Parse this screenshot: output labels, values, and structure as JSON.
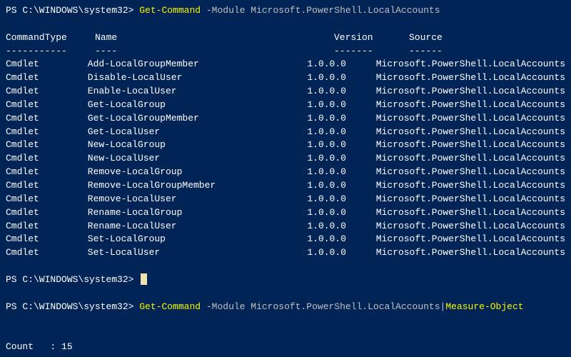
{
  "prompt1": {
    "path": "PS C:\\WINDOWS\\system32> ",
    "cmdlet": "Get-Command",
    "param": " -Module ",
    "arg": "Microsoft.PowerShell.LocalAccounts"
  },
  "headers": {
    "type": "CommandType",
    "name": "Name",
    "version": "Version",
    "source": "Source"
  },
  "dashes": {
    "type": "-----------",
    "name": "----",
    "version": "-------",
    "source": "------"
  },
  "rows": [
    {
      "type": "Cmdlet",
      "name": "Add-LocalGroupMember",
      "version": "1.0.0.0",
      "source": "Microsoft.PowerShell.LocalAccounts"
    },
    {
      "type": "Cmdlet",
      "name": "Disable-LocalUser",
      "version": "1.0.0.0",
      "source": "Microsoft.PowerShell.LocalAccounts"
    },
    {
      "type": "Cmdlet",
      "name": "Enable-LocalUser",
      "version": "1.0.0.0",
      "source": "Microsoft.PowerShell.LocalAccounts"
    },
    {
      "type": "Cmdlet",
      "name": "Get-LocalGroup",
      "version": "1.0.0.0",
      "source": "Microsoft.PowerShell.LocalAccounts"
    },
    {
      "type": "Cmdlet",
      "name": "Get-LocalGroupMember",
      "version": "1.0.0.0",
      "source": "Microsoft.PowerShell.LocalAccounts"
    },
    {
      "type": "Cmdlet",
      "name": "Get-LocalUser",
      "version": "1.0.0.0",
      "source": "Microsoft.PowerShell.LocalAccounts"
    },
    {
      "type": "Cmdlet",
      "name": "New-LocalGroup",
      "version": "1.0.0.0",
      "source": "Microsoft.PowerShell.LocalAccounts"
    },
    {
      "type": "Cmdlet",
      "name": "New-LocalUser",
      "version": "1.0.0.0",
      "source": "Microsoft.PowerShell.LocalAccounts"
    },
    {
      "type": "Cmdlet",
      "name": "Remove-LocalGroup",
      "version": "1.0.0.0",
      "source": "Microsoft.PowerShell.LocalAccounts"
    },
    {
      "type": "Cmdlet",
      "name": "Remove-LocalGroupMember",
      "version": "1.0.0.0",
      "source": "Microsoft.PowerShell.LocalAccounts"
    },
    {
      "type": "Cmdlet",
      "name": "Remove-LocalUser",
      "version": "1.0.0.0",
      "source": "Microsoft.PowerShell.LocalAccounts"
    },
    {
      "type": "Cmdlet",
      "name": "Rename-LocalGroup",
      "version": "1.0.0.0",
      "source": "Microsoft.PowerShell.LocalAccounts"
    },
    {
      "type": "Cmdlet",
      "name": "Rename-LocalUser",
      "version": "1.0.0.0",
      "source": "Microsoft.PowerShell.LocalAccounts"
    },
    {
      "type": "Cmdlet",
      "name": "Set-LocalGroup",
      "version": "1.0.0.0",
      "source": "Microsoft.PowerShell.LocalAccounts"
    },
    {
      "type": "Cmdlet",
      "name": "Set-LocalUser",
      "version": "1.0.0.0",
      "source": "Microsoft.PowerShell.LocalAccounts"
    }
  ],
  "prompt2": {
    "path": "PS C:\\WINDOWS\\system32> ",
    "cmdlet": "Get-Command",
    "param": " -Module ",
    "arg": "Microsoft.PowerShell.LocalAccounts",
    "pipe": "|",
    "cmdlet2": "Measure-Object"
  },
  "result": {
    "countLabel": "Count   : ",
    "countValue": "15"
  }
}
